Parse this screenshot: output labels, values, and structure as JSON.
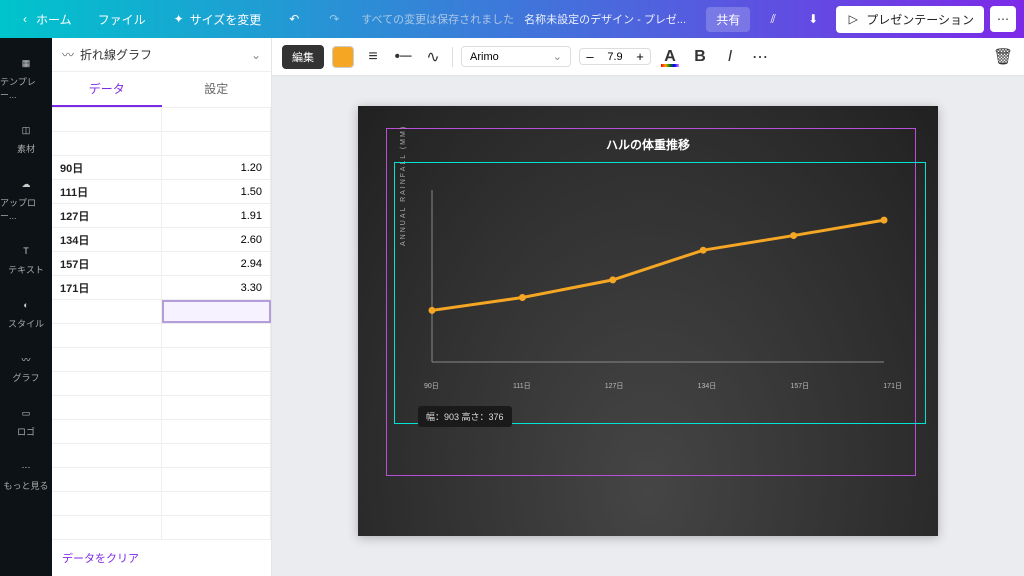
{
  "topbar": {
    "home": "ホーム",
    "file": "ファイル",
    "resize": "サイズを変更",
    "autosave": "すべての変更は保存されました",
    "doc_title": "名称未設定のデザイン - プレゼ...",
    "share": "共有",
    "present": "プレゼンテーション"
  },
  "iconrail": {
    "templates": "テンプレー...",
    "elements": "素材",
    "uploads": "アップロー...",
    "text": "テキスト",
    "style": "スタイル",
    "chart": "グラフ",
    "logo": "ロゴ",
    "more": "もっと見る"
  },
  "sidepanel": {
    "header": "折れ線グラフ",
    "tab_data": "データ",
    "tab_settings": "設定",
    "clear": "データをクリア",
    "rows": [
      {
        "a": "90日",
        "b": "1.20"
      },
      {
        "a": "111日",
        "b": "1.50"
      },
      {
        "a": "127日",
        "b": "1.91"
      },
      {
        "a": "134日",
        "b": "2.60"
      },
      {
        "a": "157日",
        "b": "2.94"
      },
      {
        "a": "171日",
        "b": "3.30"
      }
    ]
  },
  "toolbar": {
    "edit": "編集",
    "color": "#f5a623",
    "font": "Arimo",
    "font_size": "7.9"
  },
  "slide": {
    "title": "ハルの体重推移",
    "ylabel": "ANNUAL RAINFALL (MM)",
    "dims": "幅：903 高さ：376"
  },
  "chart_data": {
    "type": "line",
    "title": "ハルの体重推移",
    "ylabel": "ANNUAL RAINFALL (MM)",
    "categories": [
      "90日",
      "111日",
      "127日",
      "134日",
      "157日",
      "171日"
    ],
    "values": [
      1.2,
      1.5,
      1.91,
      2.6,
      2.94,
      3.3
    ],
    "ylim": [
      0,
      4
    ],
    "line_color": "#f5a623"
  }
}
